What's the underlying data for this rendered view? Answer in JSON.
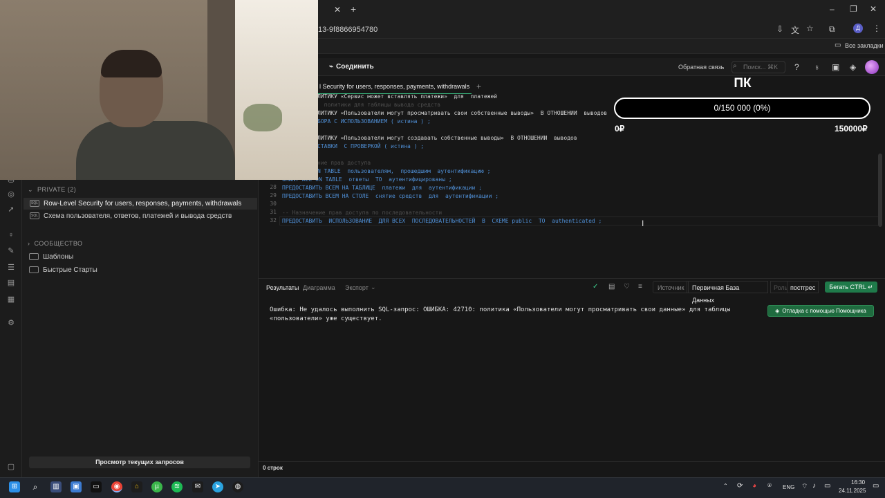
{
  "browser": {
    "url_fragment": "13-9f8866954780",
    "bookmarks_label": "Все закладки"
  },
  "app_header": {
    "connect_label": "Соединить",
    "feedback_label": "Обратная связь",
    "search_placeholder": "Поиск...",
    "search_shortcut": "⌘K"
  },
  "query_tab": {
    "title": "l Security for users, responses, payments, withdrawals"
  },
  "explorer": {
    "private_title": "PRIVATE (2)",
    "private_items": [
      "Row-Level Security for users, responses, payments, withdrawals",
      "Схема пользователя, ответов, платежей и вывода средств"
    ],
    "community_title": "СООБЩЕСТВО",
    "community_items": [
      "Шаблоны",
      "Быстрые Старты"
    ],
    "view_queries_label": "Просмотр текущих запросов"
  },
  "overlay": {
    "title": "ПК",
    "progress_text": "0/150 000 (0%)",
    "progress_fraction": 0,
    "min_label": "0₽",
    "max_label": "150000₽"
  },
  "code": {
    "line_numbers": [
      "28",
      "29",
      "30",
      "31",
      "32"
    ],
    "partial_lines": [
      "ЛИТИКУ «Сервис может вставлять платежи»  для  платежей",
      "  политики для таблицы вывода средств",
      "ЛИТИКУ «Пользователи могут просматривать свои собственные выводы»  В ОТНОШЕНИИ  выводов",
      "БОРА С ИСПОЛЬЗОВАНИЕМ ( истина ) ;",
      "ЛИТИКУ «Пользователи могут создавать собственные выводы»  В ОТНОШЕНИИ  выводов",
      "СТАВКИ  С ПРОВЕРКОЙ ( истина ) ;",
      "ние прав доступа",
      "N TABLE  пользователям,  прошедшим  аутентификацию ;",
      "GRANT ALL ON TABLE  ответы  TO  аутентифицированы ;"
    ],
    "line28": "ПРЕДОСТАВИТЬ ВСЕМ НА ТАБЛИЦЕ  платежи  для  аутентификации ;",
    "line29": "ПРЕДОСТАВИТЬ ВСЕМ НА СТОЛЕ  снятие средств  для  аутентификации ;",
    "line31": "-- Назначение прав доступа по последовательности",
    "line32": "ПРЕДОСТАВИТЬ  ИСПОЛЬЗОВАНИЕ  ДЛЯ ВСЕХ  ПОСЛЕДОВАТЕЛЬНОСТЕЙ  В  СХЕМЕ public  TO  authenticated ;"
  },
  "results": {
    "tabs": [
      "Результаты",
      "Диаграмма",
      "Экспорт"
    ],
    "source_label": "Источник",
    "db_label": "Первичная База Данных",
    "role_label": "Роль",
    "role_value": "постгрес",
    "run_label": "Бегать  CTRL ↵",
    "error_text": "Ошибка: Не удалось выполнить SQL-запрос: ОШИБКА: 42710: политика «Пользователи могут просматривать свои данные» для таблицы «пользователи» уже существует.",
    "assist_label": "Отладка с помощью Помощника",
    "rows_label": "0 строк"
  },
  "taskbar": {
    "lang": "ENG",
    "time": "16:30",
    "date": "24.11.2025"
  },
  "colors": {
    "accent": "#3ecf8e",
    "keyword": "#4f8fd6",
    "run_button": "#1f7a4a"
  }
}
